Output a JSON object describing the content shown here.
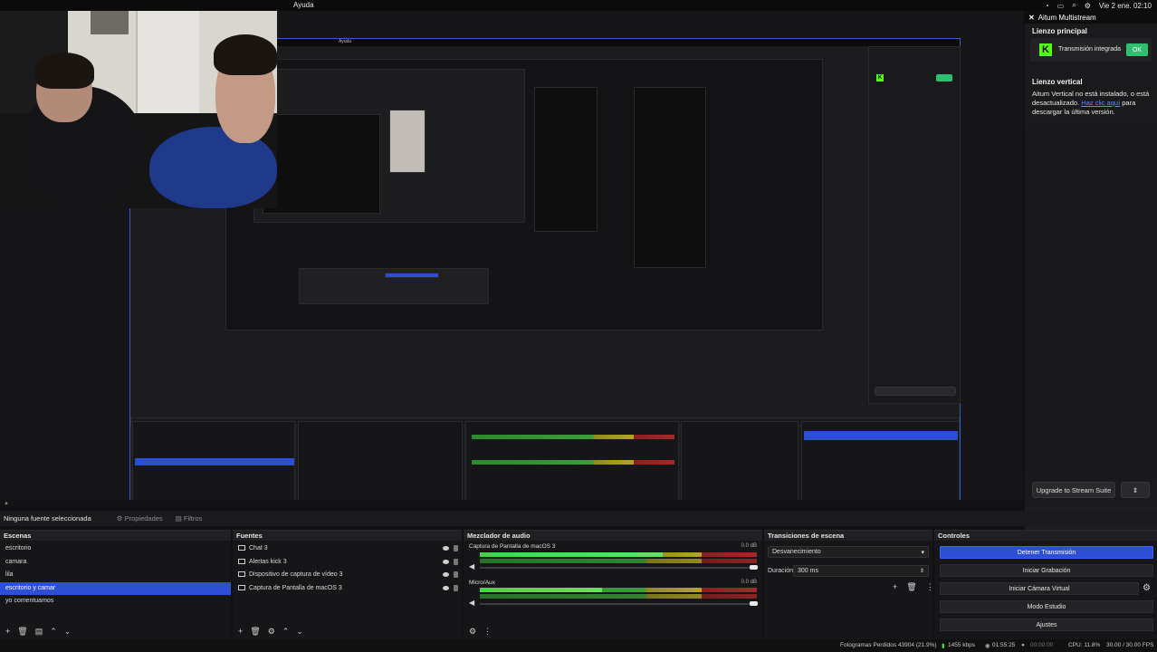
{
  "menubar": {
    "help": "Ayuda",
    "datetime": "Vie 2 ene.  02:10"
  },
  "multistream": {
    "title": "Aitum Multistream",
    "main_title": "Lienzo principal",
    "kick_label": "Transmisión integrada",
    "ok_label": "OK",
    "vertical_title": "Lienzo vertical",
    "vertical_msg_1": "Aitum Vertical no está instalado, o está desactualizado.",
    "vertical_link": "Haz clic aquí",
    "vertical_msg_2": "para descargar la última versión.",
    "upgrade_label": "Upgrade to Stream Suite"
  },
  "sourcebar": {
    "no_source": "Ninguna fuente seleccionada",
    "properties": "Propiedades",
    "filters": "Filtros"
  },
  "scenes": {
    "title": "Escenas",
    "items": [
      "escritorio",
      "camara",
      "lila",
      "escritorio y camar",
      "yo comentuamos"
    ],
    "selected_index": 3
  },
  "sources": {
    "title": "Fuentes",
    "items": [
      "Chat 3",
      "Alertas kick 3",
      "Dispositivo de captura de vídeo 3",
      "Captura de Pantalla de macOS 3"
    ]
  },
  "mixer": {
    "title": "Mezclador de audio",
    "channels": [
      {
        "name": "Captura de Pantalla de macOS 3",
        "db": "0.0 dB",
        "level": 0.66
      },
      {
        "name": "Micro/Aux",
        "db": "0.0 dB",
        "level": 0.44
      }
    ]
  },
  "transitions": {
    "title": "Transiciones de escena",
    "selected": "Desvanecimiento",
    "duration_label": "Duración",
    "duration_value": "300 ms"
  },
  "controls": {
    "title": "Controles",
    "buttons": [
      "Detener Transmisión",
      "Iniciar Grabación",
      "Iniciar Cámara Virtual",
      "Modo Estudio",
      "Ajustes"
    ],
    "active_index": 0
  },
  "status": {
    "dropped": "Fotogramas Perdidos 43904 (21.9%)",
    "bitrate": "1455 kbps",
    "live_time": "01:55:25",
    "rec_time": "00:00:00",
    "cpu": "CPU: 11.8%",
    "fps": "30.00 / 30.00 FPS"
  },
  "colors": {
    "accent": "#2d4fd6",
    "kick": "#53fc18",
    "ok": "#2fbf71",
    "favorite": "#e03a3a"
  }
}
